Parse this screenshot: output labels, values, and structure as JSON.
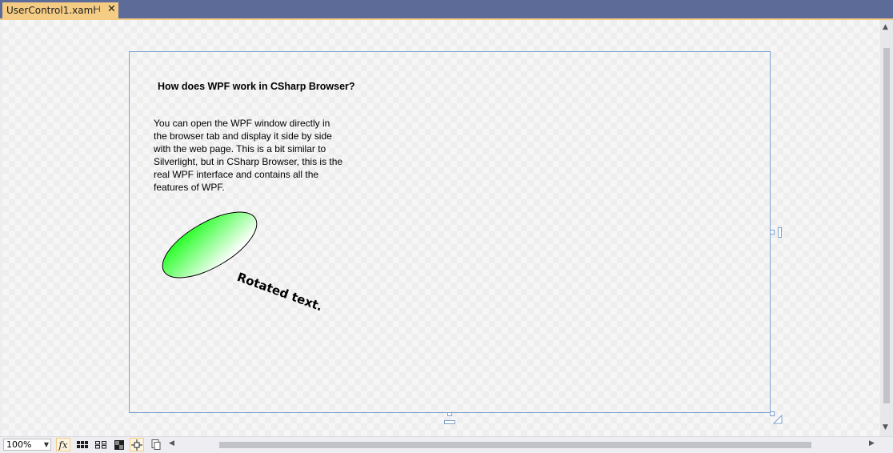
{
  "tab": {
    "title": "UserControl1.xaml",
    "pin_icon": "pin-icon",
    "close_icon": "close-icon"
  },
  "design": {
    "heading": "How does WPF work in CSharp Browser?",
    "paragraph": "You can open the WPF window directly in the browser tab and display it side by side with the web page. This is a bit similar to Silverlight, but in CSharp Browser, this is the real WPF interface and contains all the features of WPF.",
    "rotated_text": "Rotated text.",
    "ellipse_gradient": [
      "#00ff00",
      "#ffffff"
    ]
  },
  "toolbar": {
    "zoom": "100%",
    "fx_label": "fx",
    "icons": [
      "grid-icon",
      "snap-grid-icon",
      "artboard-background-icon",
      "snap-lines-icon",
      "xaml-effects-icon"
    ]
  },
  "colors": {
    "tabbar": "#5d6b99",
    "active_tab": "#f5cc84",
    "selection_border": "#7da2ce"
  }
}
